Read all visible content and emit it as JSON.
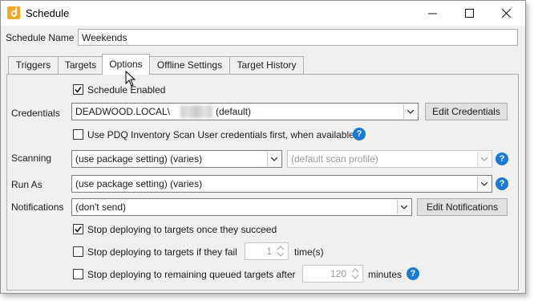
{
  "window": {
    "title": "Schedule"
  },
  "schedule_name": {
    "label": "Schedule Name",
    "value": "Weekends"
  },
  "tabs": [
    {
      "label": "Triggers",
      "active": false
    },
    {
      "label": "Targets",
      "active": false
    },
    {
      "label": "Options",
      "active": true
    },
    {
      "label": "Offline Settings",
      "active": false
    },
    {
      "label": "Target History",
      "active": false
    }
  ],
  "options": {
    "schedule_enabled": {
      "label": "Schedule Enabled",
      "checked": true
    },
    "credentials": {
      "label": "Credentials",
      "domain": "DEADWOOD.LOCAL\\",
      "suffix": "(default)",
      "edit_button": "Edit Credentials"
    },
    "use_pdq_scan": {
      "label": "Use PDQ Inventory Scan User credentials first, when available",
      "checked": false
    },
    "scanning": {
      "label": "Scanning",
      "value": "(use package setting) (varies)",
      "profile_value": "(default scan profile)"
    },
    "run_as": {
      "label": "Run As",
      "value": "(use package setting) (varies)"
    },
    "notifications": {
      "label": "Notifications",
      "value": "(don't send)",
      "edit_button": "Edit Notifications"
    },
    "stop_succeed": {
      "label": "Stop deploying to targets once they succeed",
      "checked": true
    },
    "stop_fail": {
      "label": "Stop deploying to targets if they fail",
      "checked": false,
      "count": "1",
      "unit": "time(s)"
    },
    "stop_remaining": {
      "label": "Stop deploying to remaining queued targets after",
      "checked": false,
      "count": "120",
      "unit": "minutes"
    }
  },
  "help_glyph": "?",
  "colors": {
    "accent": "#1a7ad4",
    "app_icon": "#f5a623"
  }
}
